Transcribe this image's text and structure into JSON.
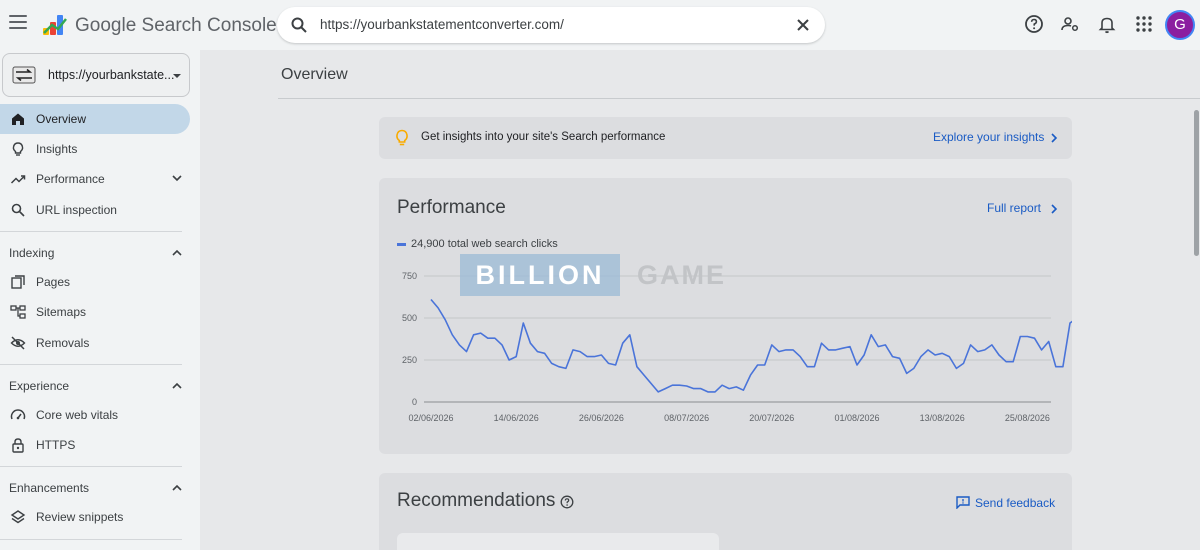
{
  "app": {
    "title": "Google Search Console"
  },
  "search": {
    "value": "https://yourbankstatementconverter.com/"
  },
  "user": {
    "avatar_letter": "G",
    "avatar_color": "#8b1ea0"
  },
  "property": {
    "label": "https://yourbankstate..."
  },
  "sidebar": {
    "items": [
      {
        "label": "Overview",
        "icon": "home-icon"
      },
      {
        "label": "Insights",
        "icon": "lightbulb-icon"
      },
      {
        "label": "Performance",
        "icon": "trending-up-icon"
      },
      {
        "label": "URL inspection",
        "icon": "search-icon"
      }
    ],
    "indexing": {
      "heading": "Indexing",
      "items": [
        {
          "label": "Pages",
          "icon": "pages-icon"
        },
        {
          "label": "Sitemaps",
          "icon": "sitemap-icon"
        },
        {
          "label": "Removals",
          "icon": "eye-off-icon"
        }
      ]
    },
    "experience": {
      "heading": "Experience",
      "items": [
        {
          "label": "Core web vitals",
          "icon": "gauge-icon"
        },
        {
          "label": "HTTPS",
          "icon": "lock-icon"
        }
      ]
    },
    "enhancements": {
      "heading": "Enhancements",
      "items": [
        {
          "label": "Review snippets",
          "icon": "layers-icon"
        }
      ]
    }
  },
  "main": {
    "title": "Overview",
    "insights": {
      "text": "Get insights into your site's Search performance",
      "link": "Explore your insights"
    },
    "performance": {
      "title": "Performance",
      "link": "Full report",
      "legend": "24,900 total web search clicks",
      "series_color": "#4a74d9"
    },
    "recommendations": {
      "title": "Recommendations",
      "feedback": "Send feedback"
    }
  },
  "watermark": {
    "part1": "BILLION",
    "part2": "GAME"
  },
  "chart_data": {
    "type": "line",
    "title": "",
    "xlabel": "",
    "ylabel": "",
    "ylim": [
      0,
      750
    ],
    "yticks": [
      0,
      250,
      500,
      750
    ],
    "xtick_labels": [
      "02/06/2026",
      "14/06/2026",
      "26/06/2026",
      "08/07/2026",
      "20/07/2026",
      "01/08/2026",
      "13/08/2026",
      "25/08/2026"
    ],
    "x_start": "2026-06-02",
    "x_interval_days": 1,
    "grid": true,
    "series": [
      {
        "name": "24,900 total web search clicks",
        "values": [
          610,
          560,
          490,
          400,
          340,
          300,
          400,
          410,
          380,
          380,
          340,
          250,
          270,
          470,
          350,
          300,
          290,
          230,
          210,
          200,
          310,
          300,
          270,
          270,
          280,
          230,
          220,
          350,
          400,
          210,
          160,
          110,
          60,
          80,
          100,
          100,
          95,
          80,
          80,
          60,
          60,
          100,
          80,
          90,
          70,
          160,
          220,
          220,
          340,
          300,
          310,
          310,
          270,
          210,
          210,
          350,
          310,
          310,
          320,
          330,
          220,
          280,
          400,
          330,
          340,
          270,
          260,
          170,
          200,
          270,
          310,
          280,
          290,
          270,
          200,
          230,
          340,
          300,
          310,
          340,
          280,
          240,
          240,
          390,
          390,
          380,
          310,
          360,
          210,
          210,
          470,
          500
        ]
      }
    ]
  }
}
